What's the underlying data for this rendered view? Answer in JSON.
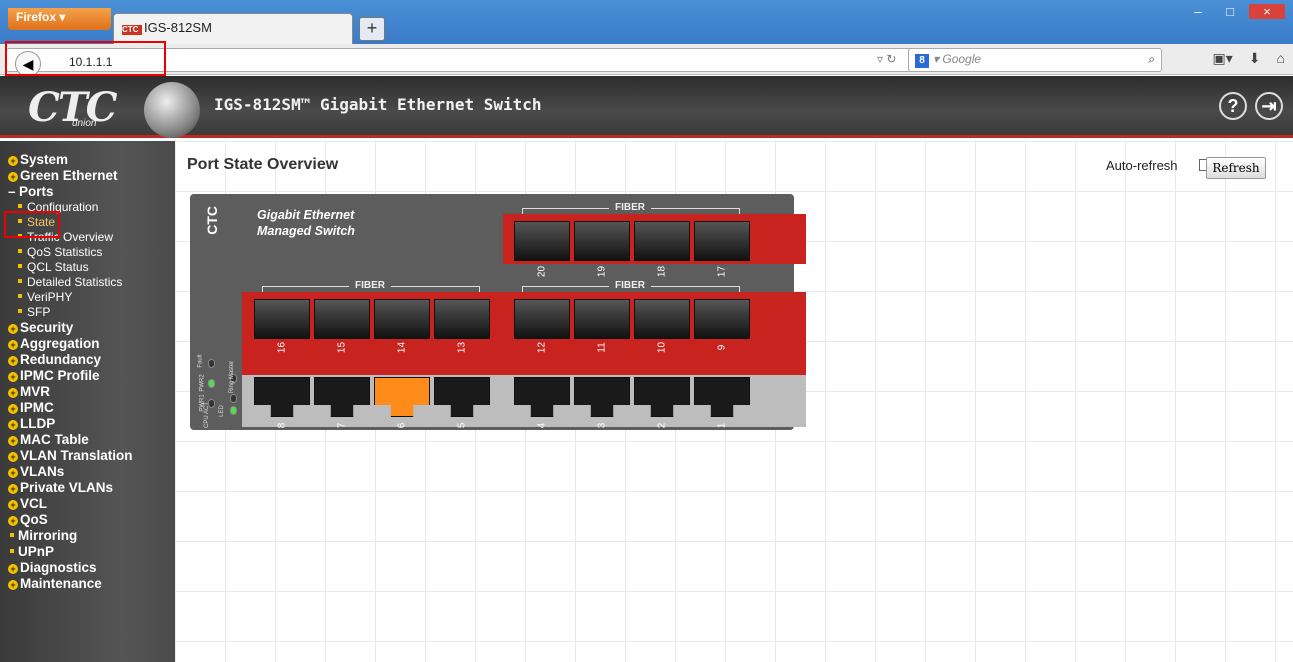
{
  "browser": {
    "firefox_label": "Firefox",
    "tab_title": "IGS-812SM",
    "tab_favicon": "CTC",
    "new_tab": "+",
    "url": "10.1.1.1",
    "search_placeholder": "Google",
    "search_engine_icon": "8",
    "window_controls": [
      "–",
      "□",
      "×"
    ]
  },
  "header": {
    "logo": "CTC",
    "logo_sub": "union",
    "title": "IGS-812SM™ Gigabit Ethernet Switch",
    "help_icon": "?",
    "logout_icon": "⇥"
  },
  "sidebar": {
    "items": [
      {
        "label": "System",
        "type": "plus"
      },
      {
        "label": "Green Ethernet",
        "type": "plus"
      },
      {
        "label": "Ports",
        "type": "minus"
      },
      {
        "label": "Configuration",
        "type": "sub"
      },
      {
        "label": "State",
        "type": "sub",
        "active": true
      },
      {
        "label": "Traffic Overview",
        "type": "sub"
      },
      {
        "label": "QoS Statistics",
        "type": "sub"
      },
      {
        "label": "QCL Status",
        "type": "sub"
      },
      {
        "label": "Detailed Statistics",
        "type": "sub"
      },
      {
        "label": "VeriPHY",
        "type": "sub"
      },
      {
        "label": "SFP",
        "type": "sub"
      },
      {
        "label": "Security",
        "type": "plus"
      },
      {
        "label": "Aggregation",
        "type": "plus"
      },
      {
        "label": "Redundancy",
        "type": "plus"
      },
      {
        "label": "IPMC Profile",
        "type": "plus"
      },
      {
        "label": "MVR",
        "type": "plus"
      },
      {
        "label": "IPMC",
        "type": "plus"
      },
      {
        "label": "LLDP",
        "type": "plus"
      },
      {
        "label": "MAC Table",
        "type": "plus"
      },
      {
        "label": "VLAN Translation",
        "type": "plus"
      },
      {
        "label": "VLANs",
        "type": "plus"
      },
      {
        "label": "Private VLANs",
        "type": "plus"
      },
      {
        "label": "VCL",
        "type": "plus"
      },
      {
        "label": "QoS",
        "type": "plus"
      },
      {
        "label": "Mirroring",
        "type": "leaf"
      },
      {
        "label": "UPnP",
        "type": "leaf"
      },
      {
        "label": "Diagnostics",
        "type": "plus"
      },
      {
        "label": "Maintenance",
        "type": "plus"
      }
    ]
  },
  "main": {
    "title": "Port State Overview",
    "auto_refresh_label": "Auto-refresh",
    "auto_refresh_checked": false,
    "refresh_button": "Refresh"
  },
  "switch": {
    "brand": "CTC",
    "name_line1": "Gigabit Ethernet",
    "name_line2": "Managed Switch",
    "fiber_label": "FIBER",
    "top_fiber_ports": [
      "20",
      "19",
      "18",
      "17"
    ],
    "left_fiber_ports": [
      "16",
      "15",
      "14",
      "13"
    ],
    "right_fiber_ports": [
      "12",
      "11",
      "10",
      "9"
    ],
    "left_copper_ports": [
      "8",
      "7",
      "6",
      "5"
    ],
    "right_copper_ports": [
      "4",
      "3",
      "2",
      "1"
    ],
    "active_port": "6",
    "led_labels": [
      "Fault",
      "Ring Master",
      "PWR2",
      "PWR1",
      "CPU ACT",
      "LED"
    ]
  },
  "colors": {
    "accent_red": "#c8231f",
    "active_port": "#ff8c1a",
    "led_green": "#4de04d"
  }
}
